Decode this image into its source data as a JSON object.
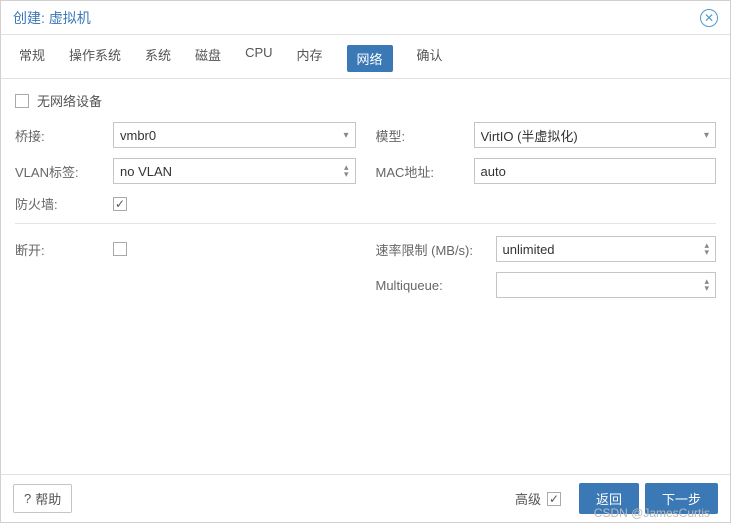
{
  "dialog": {
    "title": "创建: 虚拟机",
    "close_icon": "close"
  },
  "tabs": [
    "常规",
    "操作系统",
    "系统",
    "磁盘",
    "CPU",
    "内存",
    "网络",
    "确认"
  ],
  "active_tab_index": 6,
  "form": {
    "no_network_label": "无网络设备",
    "no_network_checked": false,
    "bridge_label": "桥接:",
    "bridge_value": "vmbr0",
    "vlan_label": "VLAN标签:",
    "vlan_value": "no VLAN",
    "firewall_label": "防火墙:",
    "firewall_checked": true,
    "model_label": "模型:",
    "model_value": "VirtIO (半虚拟化)",
    "mac_label": "MAC地址:",
    "mac_value": "auto",
    "disconnect_label": "断开:",
    "disconnect_checked": false,
    "rate_label": "速率限制 (MB/s):",
    "rate_value": "unlimited",
    "multiqueue_label": "Multiqueue:",
    "multiqueue_value": ""
  },
  "footer": {
    "help_label": "帮助",
    "advanced_label": "高级",
    "advanced_checked": true,
    "back_label": "返回",
    "next_label": "下一步"
  },
  "watermark": "CSDN @JamesCurtis"
}
